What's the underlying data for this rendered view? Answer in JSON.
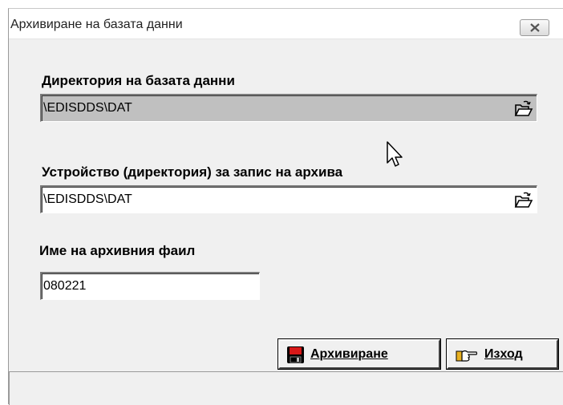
{
  "window": {
    "title": "Архивиране на базата данни"
  },
  "database_dir": {
    "label": "Директория на базата данни",
    "value": "\\EDISDDS\\DAT"
  },
  "archive_device": {
    "label": "Устройство (директория) за запис на архива",
    "value": "\\EDISDDS\\DAT"
  },
  "archive_file": {
    "label": "Име на архивния фаил",
    "value": "080221"
  },
  "buttons": {
    "archive": {
      "label": "Архивиране",
      "icon": "floppy-disk-icon"
    },
    "exit": {
      "label": "Изход",
      "icon": "pointing-hand-icon"
    }
  },
  "colors": {
    "disabled_field": "#c0c0c0",
    "window_bg": "#f0f0f0",
    "floppy_red": "#d81818"
  }
}
